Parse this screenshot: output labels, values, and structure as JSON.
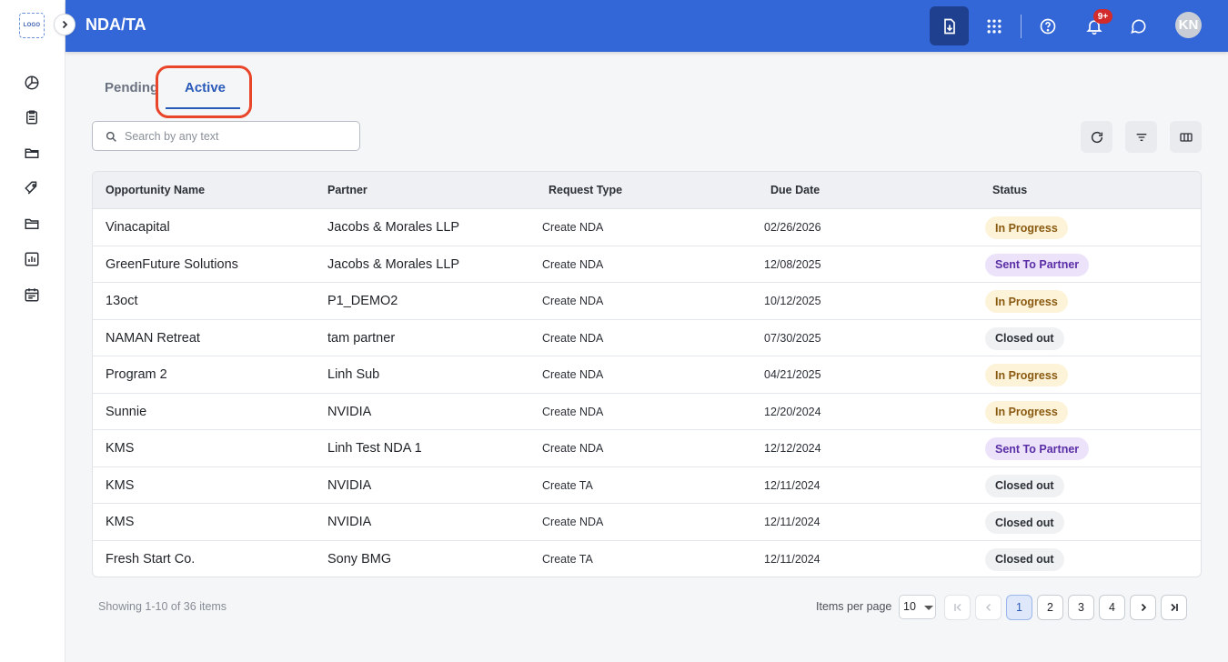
{
  "app": {
    "logo_text": "LOGO",
    "title": "NDA/TA",
    "accent_color": "#3366d6"
  },
  "sidebar": {
    "items": [
      {
        "icon": "pie-chart-icon"
      },
      {
        "icon": "clipboard-icon"
      },
      {
        "icon": "folder-open-icon"
      },
      {
        "icon": "tags-icon"
      },
      {
        "icon": "folder-icon"
      },
      {
        "icon": "bar-chart-icon"
      },
      {
        "icon": "calendar-icon"
      }
    ]
  },
  "header": {
    "notification_badge": "9+",
    "avatar_initials": "KN"
  },
  "tabs": [
    {
      "label": "Pending",
      "selected": false
    },
    {
      "label": "Active",
      "selected": true
    }
  ],
  "search": {
    "placeholder": "Search by any text",
    "value": ""
  },
  "table": {
    "columns": [
      "Opportunity Name",
      "Partner",
      "Request Type",
      "Due Date",
      "Status"
    ],
    "rows": [
      {
        "opportunity": "Vinacapital",
        "partner": "Jacobs & Morales LLP",
        "type": "Create NDA",
        "due": "02/26/2026",
        "status": "In Progress"
      },
      {
        "opportunity": "GreenFuture Solutions",
        "partner": "Jacobs & Morales LLP",
        "type": "Create NDA",
        "due": "12/08/2025",
        "status": "Sent To Partner"
      },
      {
        "opportunity": "13oct",
        "partner": "P1_DEMO2",
        "type": "Create NDA",
        "due": "10/12/2025",
        "status": "In Progress"
      },
      {
        "opportunity": "NAMAN Retreat",
        "partner": "tam partner",
        "type": "Create NDA",
        "due": "07/30/2025",
        "status": "Closed out"
      },
      {
        "opportunity": "Program 2",
        "partner": "Linh Sub",
        "type": "Create NDA",
        "due": "04/21/2025",
        "status": "In Progress"
      },
      {
        "opportunity": "Sunnie",
        "partner": "NVIDIA",
        "type": "Create NDA",
        "due": "12/20/2024",
        "status": "In Progress"
      },
      {
        "opportunity": "KMS",
        "partner": "Linh Test NDA 1",
        "type": "Create NDA",
        "due": "12/12/2024",
        "status": "Sent To Partner"
      },
      {
        "opportunity": "KMS",
        "partner": "NVIDIA",
        "type": "Create TA",
        "due": "12/11/2024",
        "status": "Closed out"
      },
      {
        "opportunity": "KMS",
        "partner": "NVIDIA",
        "type": "Create NDA",
        "due": "12/11/2024",
        "status": "Closed out"
      },
      {
        "opportunity": "Fresh Start Co.",
        "partner": "Sony BMG",
        "type": "Create TA",
        "due": "12/11/2024",
        "status": "Closed out"
      }
    ],
    "status_colors": {
      "In Progress": "#fdf3d9",
      "Sent To Partner": "#ece3fb",
      "Closed out": "#eff1f3"
    }
  },
  "footer": {
    "showing_text": "Showing 1-10 of 36 items",
    "items_per_page_label": "Items per page",
    "items_per_page_value": "10",
    "pages": [
      "1",
      "2",
      "3",
      "4"
    ],
    "current_page": "1"
  }
}
